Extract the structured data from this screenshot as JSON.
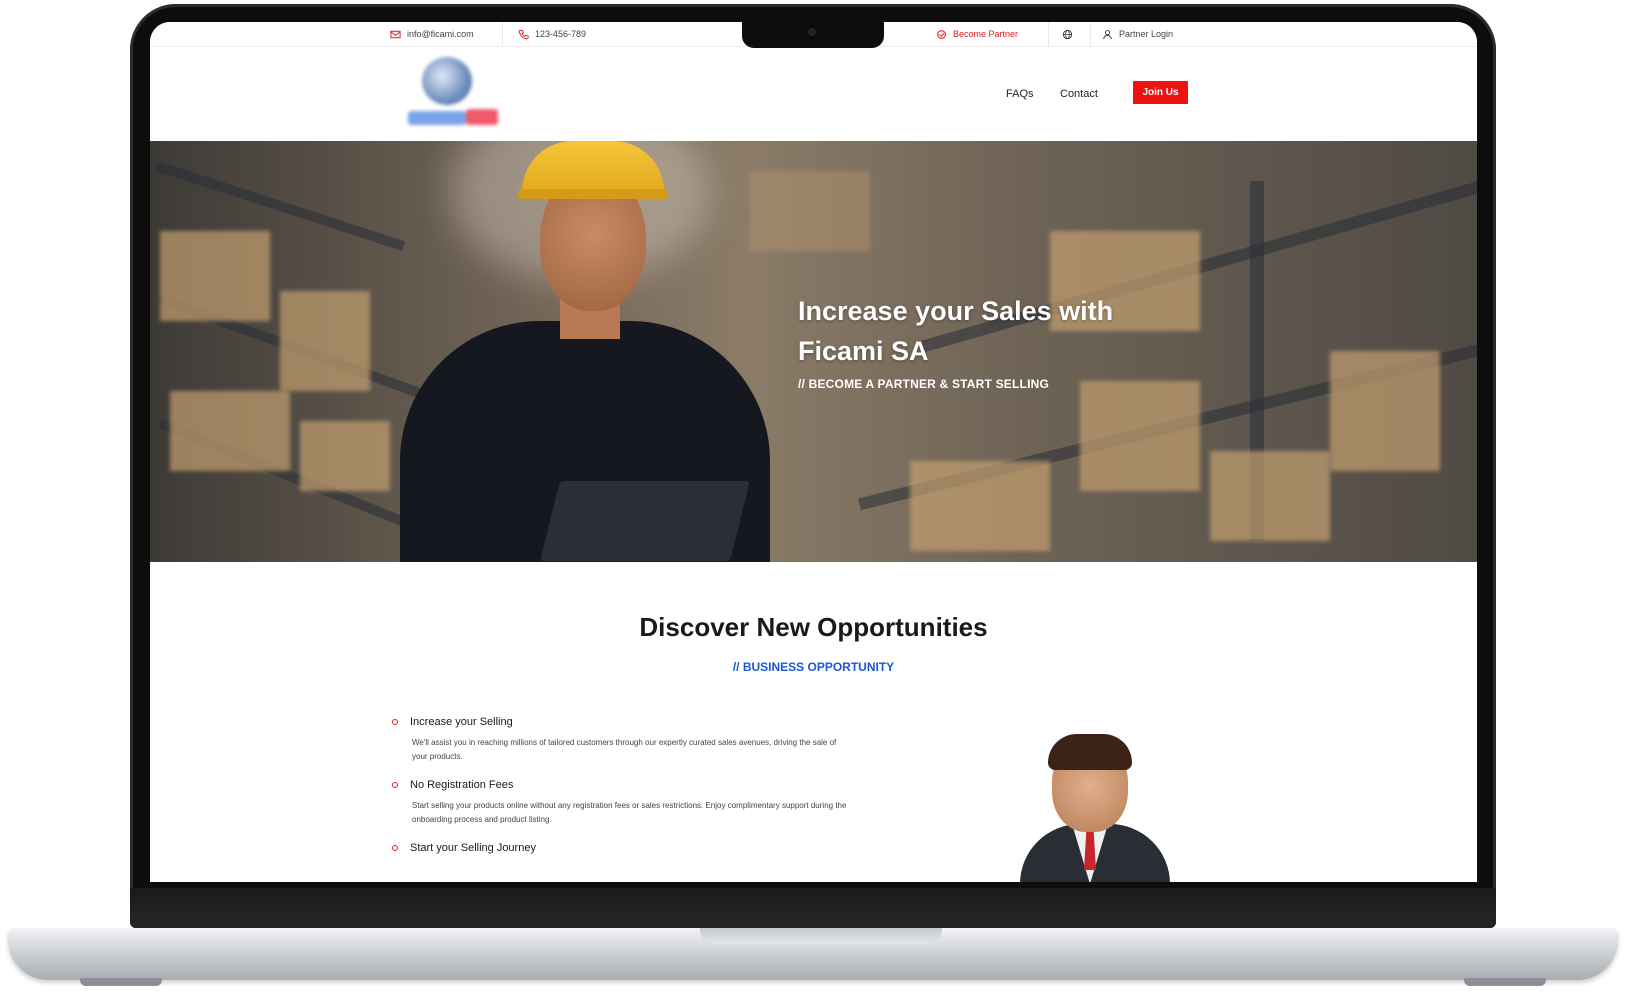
{
  "topbar": {
    "email": "info@ficami.com",
    "phone": "123-456-789",
    "become_partner": "Become Partner",
    "partner_login": "Partner Login"
  },
  "nav": {
    "faqs": "FAQs",
    "contact": "Contact",
    "join": "Join Us"
  },
  "hero": {
    "title": "Increase your Sales with Ficami SA",
    "subtitle": "// BECOME A PARTNER & START SELLING"
  },
  "section": {
    "title": "Discover New Opportunities",
    "subtitle": "// BUSINESS OPPORTUNITY",
    "features": [
      {
        "title": "Increase your Selling",
        "desc": "We'll assist you in reaching millions of tailored customers through our expertly curated sales avenues, driving the sale of your products."
      },
      {
        "title": "No Registration Fees",
        "desc": "Start selling your products online without any registration fees or sales restrictions. Enjoy complimentary support during the onboarding process and product listing."
      },
      {
        "title": "Start your Selling Journey"
      }
    ]
  },
  "colors": {
    "accent_red": "#ee1212",
    "accent_blue": "#1b57d6"
  }
}
